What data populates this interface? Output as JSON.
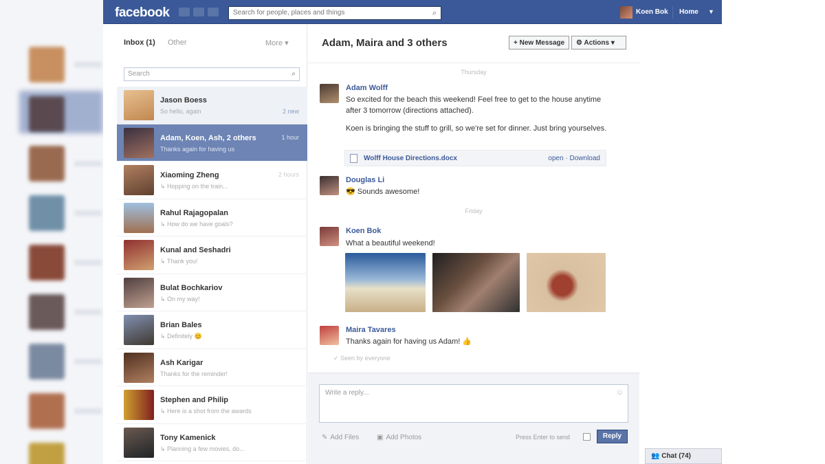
{
  "header": {
    "logo": "facebook",
    "search_placeholder": "Search for people, places and things",
    "user_name": "Koen Bok",
    "home_label": "Home"
  },
  "inbox": {
    "tab_inbox": "Inbox (1)",
    "tab_other": "Other",
    "tab_more": "More ▾",
    "search_placeholder": "Search",
    "threads": [
      {
        "name": "Jason Boess",
        "snippet": "So hello, again",
        "time": "",
        "count": "2 new"
      },
      {
        "name": "Adam, Koen, Ash, 2 others",
        "snippet": "Thanks again for having us",
        "time": "1 hour",
        "count": ""
      },
      {
        "name": "Xiaoming Zheng",
        "snippet": "↳ Hopping on the train...",
        "time": "2 hours",
        "count": ""
      },
      {
        "name": "Rahul Rajagopalan",
        "snippet": "↳ How do we have goals?",
        "time": "",
        "count": ""
      },
      {
        "name": "Kunal and Seshadri",
        "snippet": "↳ Thank you!",
        "time": "",
        "count": ""
      },
      {
        "name": "Bulat Bochkariov",
        "snippet": "↳ On my way!",
        "time": "",
        "count": ""
      },
      {
        "name": "Brian Bales",
        "snippet": "↳ Definitely 😊",
        "time": "",
        "count": ""
      },
      {
        "name": "Ash Karigar",
        "snippet": "Thanks for the reminder!",
        "time": "",
        "count": ""
      },
      {
        "name": "Stephen and Philip",
        "snippet": "↳ Here is a shot from the awards",
        "time": "",
        "count": ""
      },
      {
        "name": "Tony Kamenick",
        "snippet": "↳ Planning a few movies, do...",
        "time": "",
        "count": ""
      }
    ]
  },
  "conversation": {
    "title": "Adam, Maira and 3 others",
    "new_message_label": "+ New Message",
    "actions_label": "⚙ Actions ▾",
    "day_thursday": "Thursday",
    "day_friday": "Friday",
    "messages": [
      {
        "author": "Adam Wolff",
        "text1": "So excited for the beach this weekend! Feel free to get to the house anytime after 3 tomorrow (directions attached).",
        "text2": "Koen is bringing the stuff to grill, so we're set for dinner. Just bring yourselves.",
        "time": ""
      },
      {
        "author": "Douglas Li",
        "text1": "😎 Sounds awesome!",
        "time": ""
      },
      {
        "author": "Koen Bok",
        "text1": "What a beautiful weekend!",
        "time": ""
      },
      {
        "author": "Maira Tavares",
        "text1": "Thanks again for having us Adam! 👍",
        "time": ""
      }
    ],
    "attachment": {
      "name": "Wolff House Directions.docx",
      "actions": "open · Download"
    },
    "seen": "✓ Seen by everyone"
  },
  "composer": {
    "placeholder": "Write a reply...",
    "add_files": "Add Files",
    "add_photos": "Add Photos",
    "press_enter": "Press Enter to send",
    "reply_label": "Reply"
  },
  "chat": {
    "label": "👥 Chat (74)"
  },
  "colors": {
    "brand": "#3b5998",
    "active_thread": "#6d84b4"
  }
}
